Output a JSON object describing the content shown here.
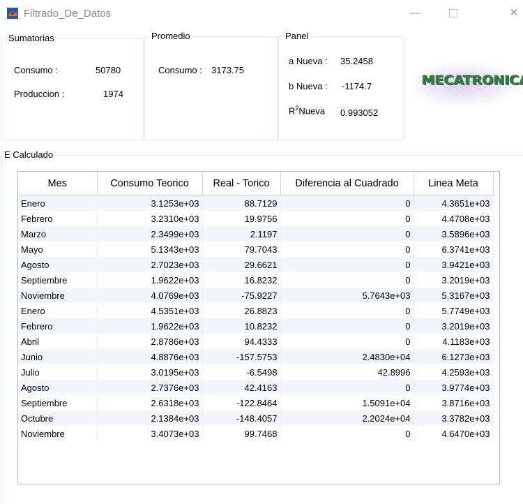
{
  "window": {
    "title": "Filtrado_De_Datos",
    "minimize": "—",
    "close": "✕"
  },
  "sumatorias": {
    "title": "Sumatorias",
    "consumo_label": "Consumo :",
    "consumo_value": "50780",
    "produccion_label": "Produccion :",
    "produccion_value": "1974"
  },
  "promedio": {
    "title": "Promedio",
    "consumo_label": "Consumo :",
    "consumo_value": "3173.75"
  },
  "panel": {
    "title": "Panel",
    "a_label": "a Nueva :",
    "a_value": "35.2458",
    "b_label": "b Nueva :",
    "b_value": "-1174.7",
    "r_label_base": "R",
    "r_label_sup": "2",
    "r_label_rest": "Nueva",
    "r_value": "0.993052"
  },
  "logo": {
    "text": "MECATRONICA"
  },
  "e_calculado": {
    "title": "E Calculado",
    "columns": [
      "Mes",
      "Consumo Teorico",
      "Real - Torico",
      "Diferencia al Cuadrado",
      "Linea Meta"
    ],
    "rows": [
      [
        "Enero",
        "3.1253e+03",
        "88.7129",
        "0",
        "4.3651e+03"
      ],
      [
        "Febrero",
        "3.2310e+03",
        "19.9756",
        "0",
        "4.4708e+03"
      ],
      [
        "Marzo",
        "2.3499e+03",
        "2.1197",
        "0",
        "3.5896e+03"
      ],
      [
        "Mayo",
        "5.1343e+03",
        "79.7043",
        "0",
        "6.3741e+03"
      ],
      [
        "Agosto",
        "2.7023e+03",
        "29.6621",
        "0",
        "3.9421e+03"
      ],
      [
        "Septiembre",
        "1.9622e+03",
        "16.8232",
        "0",
        "3.2019e+03"
      ],
      [
        "Noviembre",
        "4.0769e+03",
        "-75.9227",
        "5.7643e+03",
        "5.3167e+03"
      ],
      [
        "Enero",
        "4.5351e+03",
        "26.8823",
        "0",
        "5.7749e+03"
      ],
      [
        "Febrero",
        "1.9622e+03",
        "10.8232",
        "0",
        "3.2019e+03"
      ],
      [
        "Abril",
        "2.8786e+03",
        "94.4333",
        "0",
        "4.1183e+03"
      ],
      [
        "Junio",
        "4.8876e+03",
        "-157.5753",
        "2.4830e+04",
        "6.1273e+03"
      ],
      [
        "Julio",
        "3.0195e+03",
        "-6.5498",
        "42.8996",
        "4.2593e+03"
      ],
      [
        "Agosto",
        "2.7376e+03",
        "42.4163",
        "0",
        "3.9774e+03"
      ],
      [
        "Septiembre",
        "2.6318e+03",
        "-122.8464",
        "1.5091e+04",
        "3.8716e+03"
      ],
      [
        "Octubre",
        "2.1384e+03",
        "-148.4057",
        "2.2024e+04",
        "3.3782e+03"
      ],
      [
        "Noviembre",
        "3.4073e+03",
        "99.7468",
        "0",
        "4.6470e+03"
      ]
    ]
  }
}
